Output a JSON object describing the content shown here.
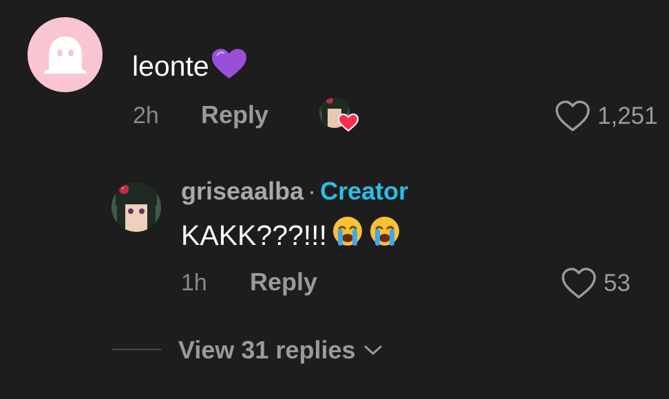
{
  "comment": {
    "author": "leonte",
    "author_emoji": "purple-heart",
    "time": "2h",
    "reply_label": "Reply",
    "creator_liked": true,
    "like_count": "1,251",
    "avatar_color": "#f8c5d0"
  },
  "reply": {
    "username": "griseaalba",
    "separator": "·",
    "badge": "Creator",
    "text": "KAKK???!!!",
    "text_emojis": [
      "crying-face",
      "crying-face"
    ],
    "time": "1h",
    "reply_label": "Reply",
    "like_count": "53"
  },
  "view_replies": {
    "label": "View 31 replies"
  },
  "colors": {
    "background": "#1d1d1d",
    "muted_text": "#9a9a9a",
    "creator_badge": "#2bbde8"
  }
}
